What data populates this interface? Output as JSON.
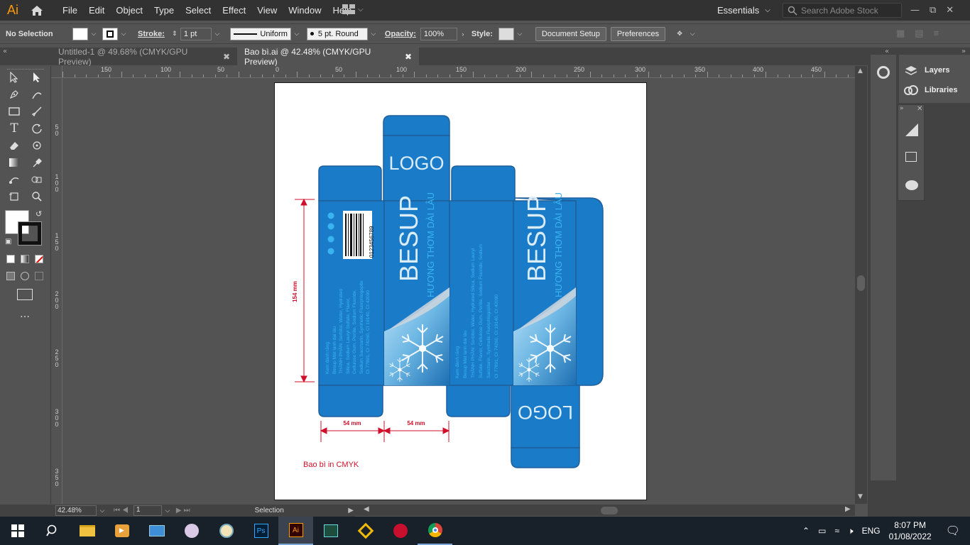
{
  "app": {
    "logo": "Ai"
  },
  "menu": [
    "File",
    "Edit",
    "Object",
    "Type",
    "Select",
    "Effect",
    "View",
    "Window",
    "Help"
  ],
  "workspace": {
    "name": "Essentials",
    "search_placeholder": "Search Adobe Stock"
  },
  "control_bar": {
    "selection": "No Selection",
    "stroke_label": "Stroke:",
    "stroke_value": "1 pt",
    "profile": "Uniform",
    "brush": "5 pt. Round",
    "opacity_label": "Opacity:",
    "opacity_value": "100%",
    "style_label": "Style:",
    "document_setup": "Document Setup",
    "preferences": "Preferences"
  },
  "tabs": [
    {
      "label": "Untitled-1 @ 49.68% (CMYK/GPU Preview)",
      "active": false
    },
    {
      "label": "Bao bì.ai @ 42.48% (CMYK/GPU Preview)",
      "active": true
    }
  ],
  "ruler_h": [
    "150",
    "100",
    "50",
    "0",
    "50",
    "100",
    "150",
    "200",
    "250",
    "300",
    "350",
    "400",
    "450"
  ],
  "ruler_v": [
    "5\n0",
    "1\n0\n0",
    "1\n5\n0",
    "2\n0\n0",
    "2\n5\n0",
    "3\n0\n0",
    "3\n5\n0"
  ],
  "artwork": {
    "logo_top": "LOGO",
    "logo_bottom": "LOGO",
    "brand": "BESUP",
    "tagline": "HƯƠNG THƠM DÀI LÂU",
    "barcode_number": "0123456789",
    "dim_height": "154 mm",
    "dim_width1": "54 mm",
    "dim_width2": "54 mm",
    "caption": "Bao bì in CMYK",
    "ingredients_left": [
      "Kem đánh răng",
      "Besup Mát lạnh dài lâu",
      "THÀNH PHẦN: Sorbitol, Water, Hydrated",
      "Silica, Sodium Lauryl Sulfate, Flavor,",
      "Cellulose Gum, Perlite, Sodium Fluoride,",
      "Sodium Saccharin, Synthetic Fluorphlogopite",
      "CI 77891, CI 74260, CI 19140, CI 42090"
    ],
    "ingredients_right": [
      "Kem đánh răng",
      "Besup Mát lạnh dài lâu",
      "THÀNH PHẦN: Sorbitol, Water, Hydrated Silica, Sodium Lauryl",
      "Sulfate, Flavor, Cellulose Gum, Perlite, Sodium Fluoride, Sodium",
      "Saccharin, Synthetic Fluorphlogopite",
      "CI 77891, CI 74260, CI 19140, CI 42090"
    ]
  },
  "status": {
    "zoom": "42.48%",
    "artboard": "1",
    "tool": "Selection"
  },
  "panels": {
    "layers": "Layers",
    "libraries": "Libraries"
  },
  "taskbar": {
    "lang": "ENG",
    "time": "8:07 PM",
    "date": "01/08/2022"
  },
  "colors": {
    "box_blue": "#1a7cc9",
    "accent_orange": "#ff9a00",
    "dimension_red": "#d0102a"
  }
}
